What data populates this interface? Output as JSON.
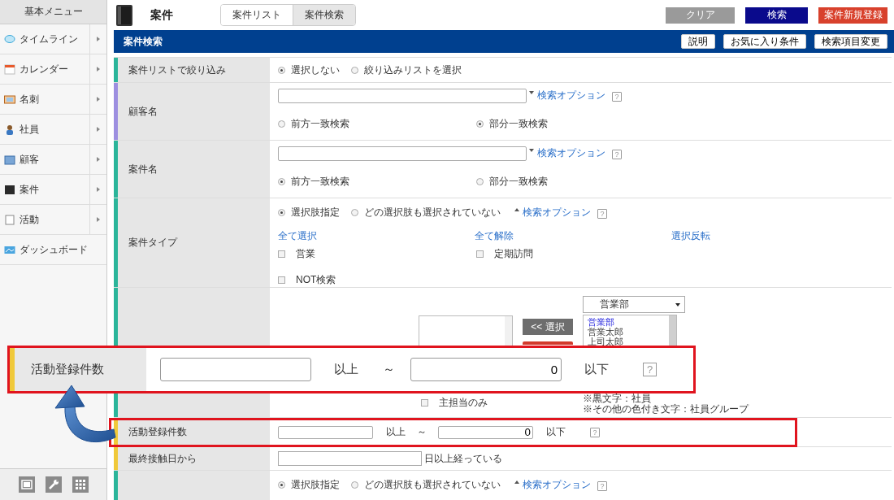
{
  "sidebar": {
    "title": "基本メニュー",
    "items": [
      {
        "label": "タイムライン",
        "submenu": true
      },
      {
        "label": "カレンダー",
        "submenu": true
      },
      {
        "label": "名刺",
        "submenu": true
      },
      {
        "label": "社員",
        "submenu": true
      },
      {
        "label": "顧客",
        "submenu": true
      },
      {
        "label": "案件",
        "submenu": true
      },
      {
        "label": "活動",
        "submenu": true
      },
      {
        "label": "ダッシュボード",
        "submenu": false
      }
    ]
  },
  "header": {
    "title": "案件",
    "tabs": [
      {
        "label": "案件リスト",
        "selected": false
      },
      {
        "label": "案件検索",
        "selected": true
      }
    ],
    "buttons": [
      {
        "label": "クリア",
        "kind": "clear"
      },
      {
        "label": "検索",
        "kind": "primary"
      },
      {
        "label": "案件新規登録",
        "kind": "danger"
      }
    ]
  },
  "panel": {
    "title": "案件検索",
    "buttons": [
      "説明",
      "お気に入り条件",
      "検索項目変更"
    ]
  },
  "rows": [
    {
      "kind": "radios",
      "label": "案件リストで絞り込み",
      "color": "#2bb59a",
      "options": [
        {
          "label": "選択しない",
          "selected": true
        },
        {
          "label": "絞り込みリストを選択",
          "selected": false
        }
      ]
    },
    {
      "kind": "text",
      "label": "顧客名",
      "color": "#9d8fe0",
      "option_link": "検索オプション",
      "option_expanded": false,
      "help": "?",
      "options": [
        {
          "label": "前方一致検索",
          "selected": false
        },
        {
          "label": "部分一致検索",
          "selected": true
        }
      ]
    },
    {
      "kind": "text",
      "label": "案件名",
      "color": "#2bb59a",
      "option_link": "検索オプション",
      "option_expanded": false,
      "help": "?",
      "options": [
        {
          "label": "前方一致検索",
          "selected": true
        },
        {
          "label": "部分一致検索",
          "selected": false
        }
      ]
    },
    {
      "kind": "choice",
      "label": "案件タイプ",
      "color": "#2bb59a",
      "modes": [
        {
          "label": "選択肢指定",
          "selected": true
        },
        {
          "label": "どの選択肢も選択されていない",
          "selected": false
        }
      ],
      "option_link": "検索オプション",
      "option_expanded": true,
      "help": "?",
      "links": [
        "全て選択",
        "全て解除",
        "選択反転"
      ],
      "checks": [
        {
          "label": "営業",
          "checked": false
        },
        {
          "label": "定期訪問",
          "checked": false
        },
        {
          "label": "NOT検索",
          "checked": false
        }
      ]
    },
    {
      "kind": "member",
      "color": "#2bb59a",
      "select_button": "<< 選択",
      "department": "営業部",
      "members": [
        {
          "label": "営業部",
          "kind": "group"
        },
        {
          "label": "営業太郎",
          "kind": "person"
        },
        {
          "label": "上司太郎",
          "kind": "person"
        }
      ],
      "main_only": {
        "label": "主担当のみ",
        "checked": false
      },
      "notes": [
        "※黒文字：社員",
        "※その他の色付き文字：社員グループ"
      ]
    },
    {
      "kind": "range",
      "label": "活動登録件数",
      "color": "#f0c93a",
      "to": "0",
      "from_suffix": "以上",
      "separator": "～",
      "to_suffix": "以下",
      "help": "?",
      "highlighted": true
    },
    {
      "kind": "days",
      "label": "最終接触日から",
      "color": "#f0c93a",
      "suffix": "日以上経っている"
    },
    {
      "kind": "choice",
      "color": "#2bb59a",
      "modes": [
        {
          "label": "選択肢指定",
          "selected": true
        },
        {
          "label": "どの選択肢も選択されていない",
          "selected": false
        }
      ],
      "option_link": "検索オプション",
      "option_expanded": true,
      "help": "?"
    }
  ],
  "callout": {
    "label": "活動登録件数",
    "color": "#f0c93a",
    "to": "0",
    "from_suffix": "以上",
    "separator": "～",
    "to_suffix": "以下",
    "help": "?"
  }
}
